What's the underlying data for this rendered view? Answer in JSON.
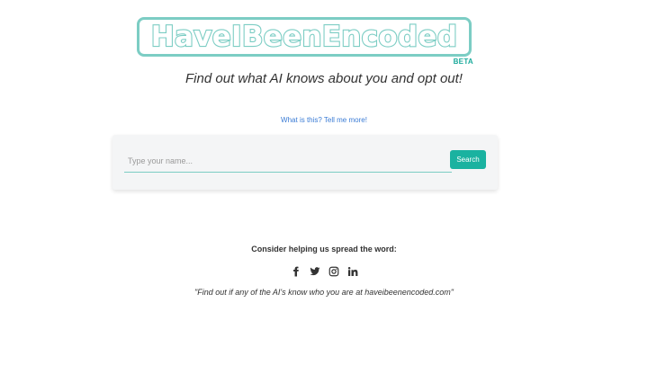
{
  "logo": {
    "text": "HaveIBeenEncoded",
    "badge": "BETA",
    "color": "#7ccdc4",
    "badge_color": "#1aaa9b"
  },
  "tagline": "Find out what AI knows about you and opt out!",
  "info_link": "What is this? Tell me more!",
  "search": {
    "placeholder": "Type your name...",
    "value": "",
    "button_label": "Search",
    "button_color": "#1ab2a0"
  },
  "share": {
    "title": "Consider helping us spread the word:",
    "icons": [
      "facebook-icon",
      "twitter-icon",
      "instagram-icon",
      "linkedin-icon"
    ],
    "quote": "\"Find out if any of the AI's know who you are at haveibeenencoded.com\""
  }
}
